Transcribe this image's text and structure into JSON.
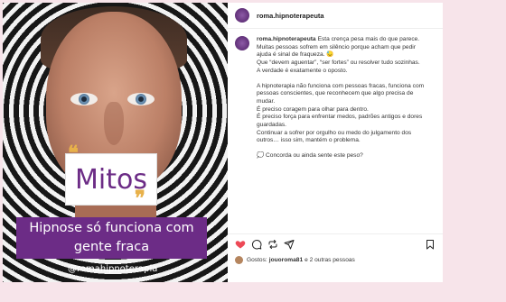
{
  "image": {
    "mitos_label": "Mitos",
    "claim_line1": "Hipnose só funciona com",
    "claim_line2": "gente fraca",
    "handle": "@romahipnoterapia",
    "quote_open": "❝",
    "quote_close": "❞"
  },
  "header": {
    "username": "roma.hipnoterapeuta"
  },
  "caption": {
    "username": "roma.hipnoterapeuta",
    "line1_rest": "Esta crença pesa mais do que parece.",
    "line2": "Muitas pessoas sofrem em silêncio porque acham que pedir",
    "line3": "ajuda é sinal de fraqueza. 😓",
    "line4": "Que “devem aguentar”, “ser fortes” ou resolver tudo sozinhas.",
    "line5": "A verdade é exatamente o oposto.",
    "line6": "A hipnoterapia não funciona com pessoas fracas, funciona com",
    "line7": "pessoas conscientes, que reconhecem que algo precisa de",
    "line8": "mudar.",
    "line9": "É preciso coragem para olhar para dentro.",
    "line10": "É preciso força para enfrentar medos, padrões antigos e dores",
    "line11": "guardadas.",
    "line12": "Continuar a sofrer por orgulho ou medo do julgamento dos",
    "line13": "outros… isso sim, mantém o problema.",
    "line14": "💭 Concorda ou ainda sente este peso?"
  },
  "likes": {
    "prefix": "Gostos:",
    "user": "jouoroma81",
    "suffix": "e 2 outras pessoas"
  },
  "icons": [
    "heart-icon",
    "comment-icon",
    "share-icon",
    "save-icon"
  ],
  "colors": {
    "accent": "#6c2c86",
    "liked": "#ed4956",
    "background": "#f7e4ea"
  }
}
